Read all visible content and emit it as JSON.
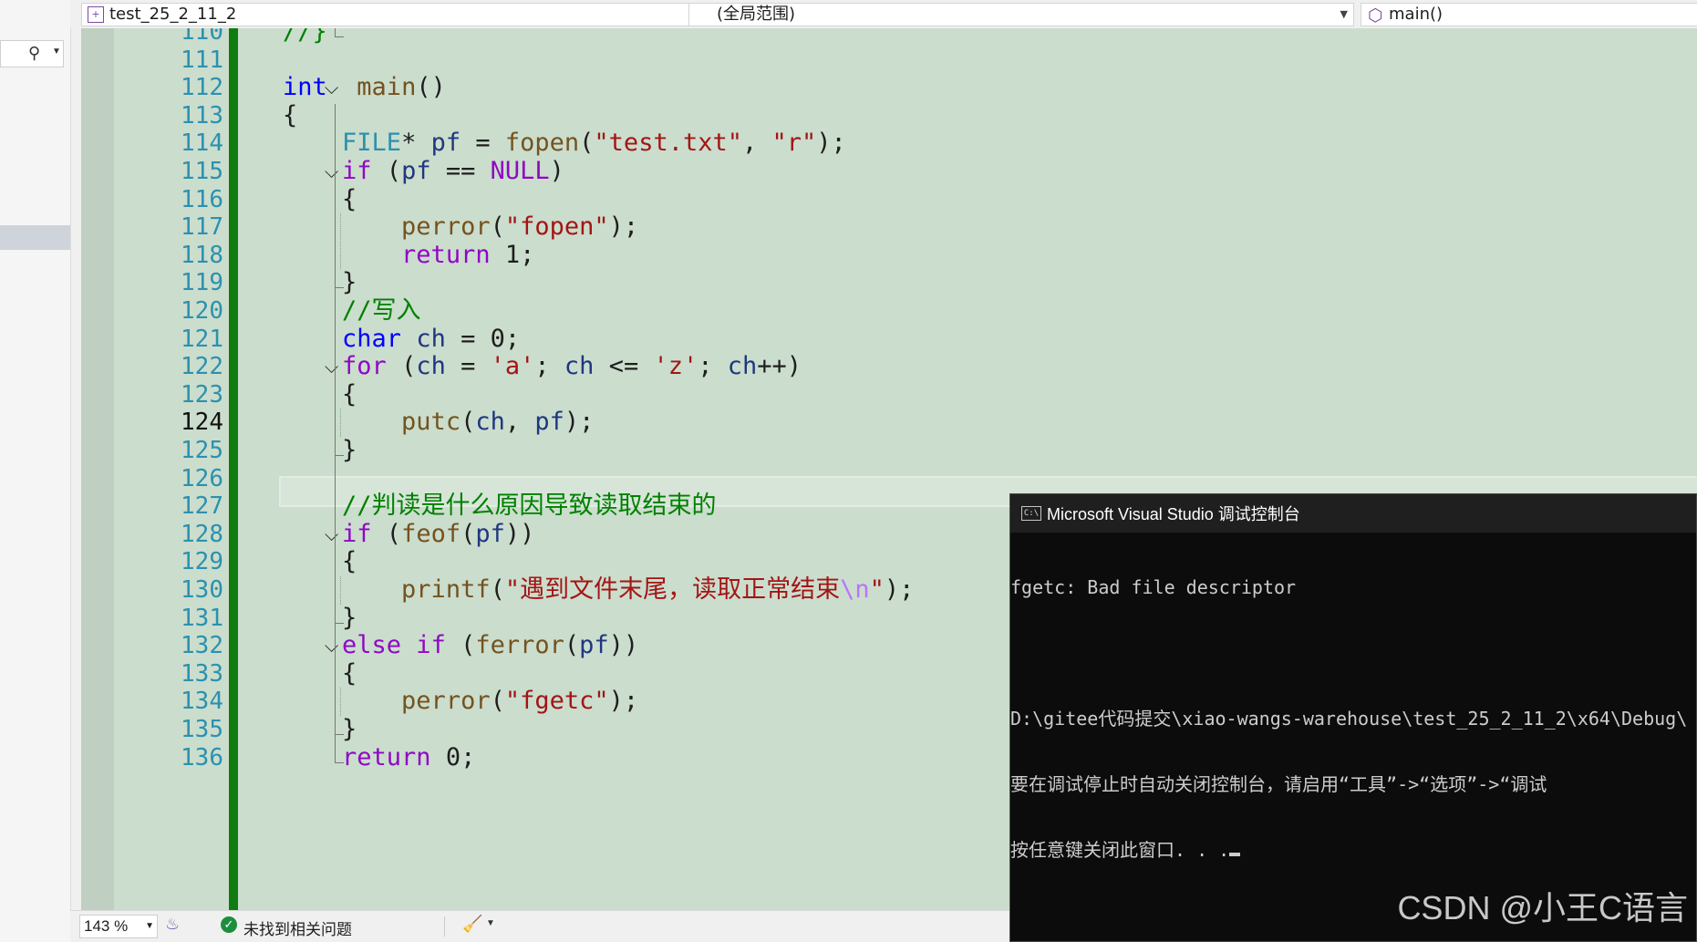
{
  "nav": {
    "project": "test_25_2_11_2",
    "scope": "(全局范围)",
    "function": "main()"
  },
  "editor": {
    "current_line": 124,
    "lines": [
      {
        "num": 110,
        "tokens": [
          [
            "cm",
            "//}"
          ]
        ]
      },
      {
        "num": 111,
        "tokens": []
      },
      {
        "num": 112,
        "tokens": [
          [
            "kw",
            "int"
          ],
          [
            "",
            "  "
          ],
          [
            "fn",
            "main"
          ],
          [
            "",
            "()"
          ]
        ]
      },
      {
        "num": 113,
        "tokens": [
          [
            "",
            "{"
          ]
        ]
      },
      {
        "num": 114,
        "tokens": [
          [
            "",
            "    "
          ],
          [
            "typ",
            "FILE"
          ],
          [
            "",
            "* "
          ],
          [
            "var",
            "pf"
          ],
          [
            "",
            " = "
          ],
          [
            "fn",
            "fopen"
          ],
          [
            "",
            "("
          ],
          [
            "str",
            "\"test.txt\""
          ],
          [
            "",
            ", "
          ],
          [
            "str",
            "\"r\""
          ],
          [
            "",
            ");"
          ]
        ]
      },
      {
        "num": 115,
        "tokens": [
          [
            "",
            "    "
          ],
          [
            "ctrl",
            "if"
          ],
          [
            "",
            " ("
          ],
          [
            "var",
            "pf"
          ],
          [
            "",
            " == "
          ],
          [
            "mac",
            "NULL"
          ],
          [
            "",
            ")"
          ]
        ]
      },
      {
        "num": 116,
        "tokens": [
          [
            "",
            "    {"
          ]
        ]
      },
      {
        "num": 117,
        "tokens": [
          [
            "",
            "        "
          ],
          [
            "fn",
            "perror"
          ],
          [
            "",
            "("
          ],
          [
            "str",
            "\"fopen\""
          ],
          [
            "",
            ");"
          ]
        ]
      },
      {
        "num": 118,
        "tokens": [
          [
            "",
            "        "
          ],
          [
            "ctrl",
            "return"
          ],
          [
            "",
            " 1;"
          ]
        ]
      },
      {
        "num": 119,
        "tokens": [
          [
            "",
            "    }"
          ]
        ]
      },
      {
        "num": 120,
        "tokens": [
          [
            "",
            "    "
          ],
          [
            "cm",
            "//写入"
          ]
        ]
      },
      {
        "num": 121,
        "tokens": [
          [
            "",
            "    "
          ],
          [
            "kw",
            "char"
          ],
          [
            "",
            " "
          ],
          [
            "var",
            "ch"
          ],
          [
            "",
            " = 0;"
          ]
        ]
      },
      {
        "num": 122,
        "tokens": [
          [
            "",
            "    "
          ],
          [
            "ctrl",
            "for"
          ],
          [
            "",
            " ("
          ],
          [
            "var",
            "ch"
          ],
          [
            "",
            " = "
          ],
          [
            "str",
            "'a'"
          ],
          [
            "",
            "; "
          ],
          [
            "var",
            "ch"
          ],
          [
            "",
            " <= "
          ],
          [
            "str",
            "'z'"
          ],
          [
            "",
            "; "
          ],
          [
            "var",
            "ch"
          ],
          [
            "",
            "++)"
          ]
        ]
      },
      {
        "num": 123,
        "tokens": [
          [
            "",
            "    {"
          ]
        ]
      },
      {
        "num": 124,
        "tokens": [
          [
            "",
            "        "
          ],
          [
            "fn",
            "putc"
          ],
          [
            "",
            "("
          ],
          [
            "var",
            "ch"
          ],
          [
            "",
            ", "
          ],
          [
            "var",
            "pf"
          ],
          [
            "",
            ");"
          ]
        ]
      },
      {
        "num": 125,
        "tokens": [
          [
            "",
            "    }"
          ]
        ]
      },
      {
        "num": 126,
        "tokens": []
      },
      {
        "num": 127,
        "tokens": [
          [
            "",
            "    "
          ],
          [
            "cm",
            "//判读是什么原因导致读取结束的"
          ]
        ]
      },
      {
        "num": 128,
        "tokens": [
          [
            "",
            "    "
          ],
          [
            "ctrl",
            "if"
          ],
          [
            "",
            " ("
          ],
          [
            "fn",
            "feof"
          ],
          [
            "",
            "("
          ],
          [
            "var",
            "pf"
          ],
          [
            "",
            "))"
          ]
        ]
      },
      {
        "num": 129,
        "tokens": [
          [
            "",
            "    {"
          ]
        ]
      },
      {
        "num": 130,
        "tokens": [
          [
            "",
            "        "
          ],
          [
            "fn",
            "printf"
          ],
          [
            "",
            "("
          ],
          [
            "str",
            "\"遇到文件末尾，读取正常结束"
          ],
          [
            "esc",
            "\\n"
          ],
          [
            "str",
            "\""
          ],
          [
            "",
            ");"
          ]
        ]
      },
      {
        "num": 131,
        "tokens": [
          [
            "",
            "    }"
          ]
        ]
      },
      {
        "num": 132,
        "tokens": [
          [
            "",
            "    "
          ],
          [
            "ctrl",
            "else if"
          ],
          [
            "",
            " ("
          ],
          [
            "fn",
            "ferror"
          ],
          [
            "",
            "("
          ],
          [
            "var",
            "pf"
          ],
          [
            "",
            "))"
          ]
        ]
      },
      {
        "num": 133,
        "tokens": [
          [
            "",
            "    {"
          ]
        ]
      },
      {
        "num": 134,
        "tokens": [
          [
            "",
            "        "
          ],
          [
            "fn",
            "perror"
          ],
          [
            "",
            "("
          ],
          [
            "str",
            "\"fgetc\""
          ],
          [
            "",
            ");"
          ]
        ]
      },
      {
        "num": 135,
        "tokens": [
          [
            "",
            "    }"
          ]
        ]
      },
      {
        "num": 136,
        "tokens": [
          [
            "",
            "    "
          ],
          [
            "ctrl",
            "return"
          ],
          [
            "",
            " 0;"
          ]
        ]
      }
    ],
    "fold_markers": [
      112,
      115,
      122,
      128,
      132
    ]
  },
  "status": {
    "zoom": "143 %",
    "issues": "未找到相关问题"
  },
  "console": {
    "title": "Microsoft Visual Studio 调试控制台",
    "lines": [
      "fgetc: Bad file descriptor",
      "",
      "D:\\gitee代码提交\\xiao-wangs-warehouse\\test_25_2_11_2\\x64\\Debug\\",
      "要在调试停止时自动关闭控制台，请启用“工具”->“选项”->“调试",
      "按任意键关闭此窗口. . ."
    ]
  },
  "watermark": "CSDN @小王C语言",
  "icons": {
    "search": "search-icon",
    "project": "cpp-project-icon",
    "function": "cube-icon",
    "status_ok": "check-circle-icon",
    "cleanup": "broom-icon",
    "console": "console-icon"
  }
}
